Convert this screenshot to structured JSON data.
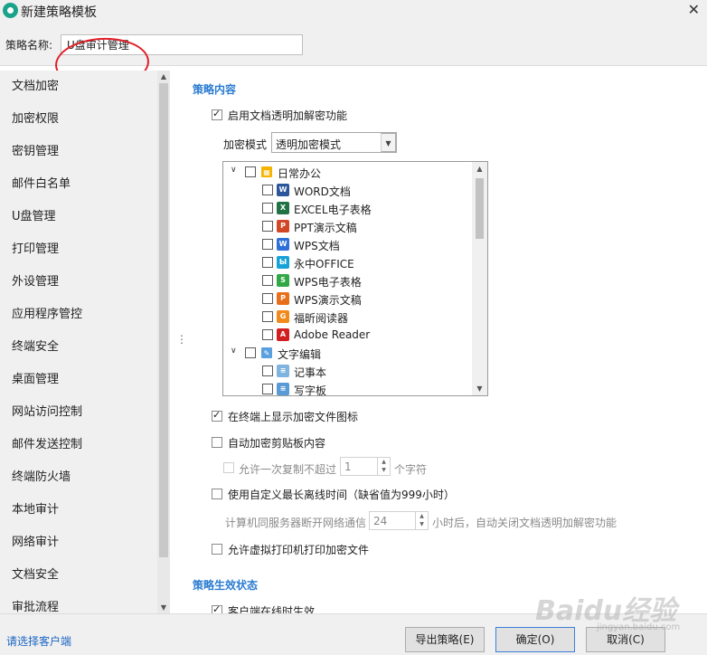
{
  "window": {
    "title": "新建策略模板"
  },
  "name_row": {
    "label": "策略名称:",
    "value": "U盘审计管理"
  },
  "sidebar": {
    "items": [
      {
        "label": "文档加密"
      },
      {
        "label": "加密权限"
      },
      {
        "label": "密钥管理"
      },
      {
        "label": "邮件白名单"
      },
      {
        "label": "U盘管理"
      },
      {
        "label": "打印管理"
      },
      {
        "label": "外设管理"
      },
      {
        "label": "应用程序管控"
      },
      {
        "label": "终端安全"
      },
      {
        "label": "桌面管理"
      },
      {
        "label": "网站访问控制"
      },
      {
        "label": "邮件发送控制"
      },
      {
        "label": "终端防火墙"
      },
      {
        "label": "本地审计"
      },
      {
        "label": "网络审计"
      },
      {
        "label": "文档安全"
      },
      {
        "label": "审批流程"
      }
    ]
  },
  "content": {
    "section1_title": "策略内容",
    "enable_transparent": {
      "label": "启用文档透明加解密功能",
      "checked": true
    },
    "encrypt_mode": {
      "label": "加密模式",
      "value": "透明加密模式"
    },
    "tree": {
      "groups": [
        {
          "label": "日常办公",
          "icon": "office-group-icon",
          "items": [
            {
              "label": "WORD文档",
              "icon": "word-icon",
              "color": "#2b579a",
              "glyph": "W"
            },
            {
              "label": "EXCEL电子表格",
              "icon": "excel-icon",
              "color": "#217346",
              "glyph": "X"
            },
            {
              "label": "PPT演示文稿",
              "icon": "ppt-icon",
              "color": "#d24726",
              "glyph": "P"
            },
            {
              "label": "WPS文档",
              "icon": "wps-writer-icon",
              "color": "#2e6fd8",
              "glyph": "W"
            },
            {
              "label": "永中OFFICE",
              "icon": "yozo-office-icon",
              "color": "#16a2d6",
              "glyph": "Ы"
            },
            {
              "label": "WPS电子表格",
              "icon": "wps-sheet-icon",
              "color": "#2fa845",
              "glyph": "S"
            },
            {
              "label": "WPS演示文稿",
              "icon": "wps-presentation-icon",
              "color": "#e8701a",
              "glyph": "P"
            },
            {
              "label": "福昕阅读器",
              "icon": "foxit-reader-icon",
              "color": "#f08a1c",
              "glyph": "G"
            },
            {
              "label": "Adobe Reader",
              "icon": "adobe-reader-icon",
              "color": "#d11f1f",
              "glyph": "A"
            }
          ]
        },
        {
          "label": "文字编辑",
          "icon": "text-edit-group-icon",
          "items": [
            {
              "label": "记事本",
              "icon": "notepad-icon",
              "color": "#7fb3e0",
              "glyph": "≡"
            },
            {
              "label": "写字板",
              "icon": "wordpad-icon",
              "color": "#5a9bd6",
              "glyph": "≡"
            }
          ]
        }
      ]
    },
    "show_icon": {
      "label": "在终端上显示加密文件图标",
      "checked": true
    },
    "auto_clipboard": {
      "label": "自动加密剪贴板内容",
      "checked": false
    },
    "allow_copy": {
      "label": "允许一次复制不超过",
      "value": "1",
      "unit": "个字符",
      "checked": false
    },
    "custom_offline": {
      "label": "使用自定义最长离线时间（缺省值为999小时）",
      "checked": false
    },
    "offline_row": {
      "prefix": "计算机同服务器断开网络通信",
      "value": "24",
      "suffix": "小时后，自动关闭文档透明加解密功能"
    },
    "virtual_printer": {
      "label": "允许虚拟打印机打印加密文件",
      "checked": false
    },
    "section2_title": "策略生效状态",
    "online_effect": {
      "label": "客户端在线时生效",
      "checked": true
    }
  },
  "footer": {
    "select_client": "请选择客户端",
    "export_button": "导出策略(E)",
    "ok_button": "确定(O)",
    "cancel_button": "取消(C)"
  },
  "watermark": {
    "main": "Baidu经验",
    "sub": "jingyan.baidu.com"
  },
  "colors": {
    "accent": "#2a7bd1",
    "annotation": "#e11d26",
    "link": "#1a64c4"
  }
}
